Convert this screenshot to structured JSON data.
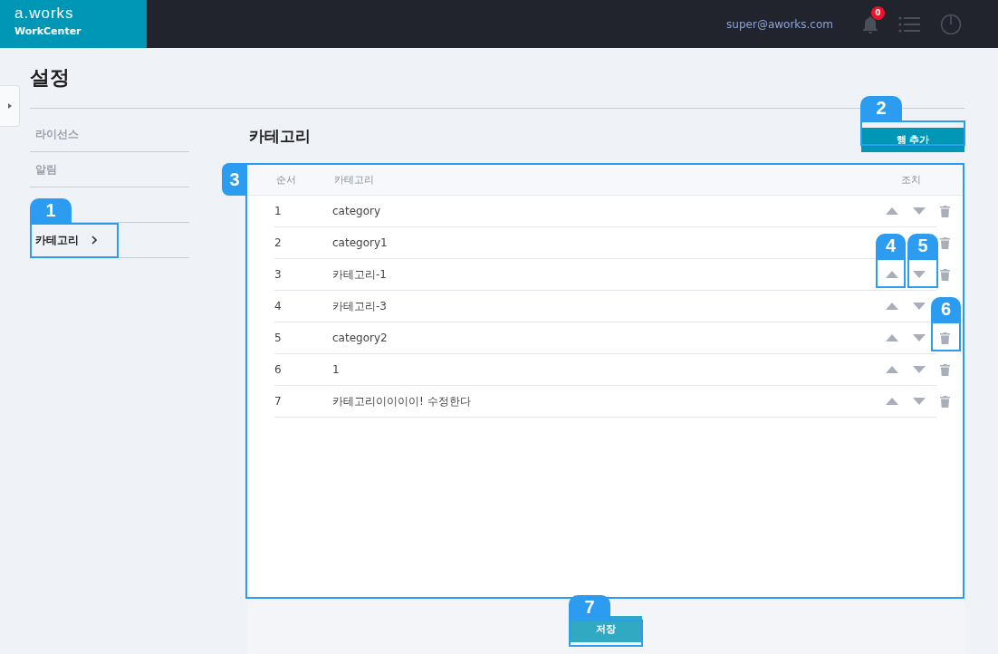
{
  "header": {
    "logo": "a.works",
    "subtitle": "WorkCenter",
    "user": "super@aworks.com",
    "notification_count": "0"
  },
  "page_title": "설정",
  "sidebar": {
    "items": [
      {
        "label": "라이선스",
        "selected": false
      },
      {
        "label": "알림",
        "selected": false
      },
      {
        "label": "카테고리",
        "selected": true
      }
    ]
  },
  "section_title": "카테고리",
  "add_row_button": "행 추가",
  "table": {
    "columns": [
      "순서",
      "카테고리",
      "조치"
    ],
    "rows": [
      {
        "order": "1",
        "category": "category"
      },
      {
        "order": "2",
        "category": "category1"
      },
      {
        "order": "3",
        "category": "카테고리-1"
      },
      {
        "order": "4",
        "category": "카테고리-3"
      },
      {
        "order": "5",
        "category": "category2"
      },
      {
        "order": "6",
        "category": "1"
      },
      {
        "order": "7",
        "category": "카테고리이이이이! 수정한다"
      }
    ]
  },
  "save_button": "저장",
  "callouts": [
    {
      "number": "1"
    },
    {
      "number": "2"
    },
    {
      "number": "3"
    },
    {
      "number": "4"
    },
    {
      "number": "5"
    },
    {
      "number": "6"
    },
    {
      "number": "7"
    }
  ]
}
